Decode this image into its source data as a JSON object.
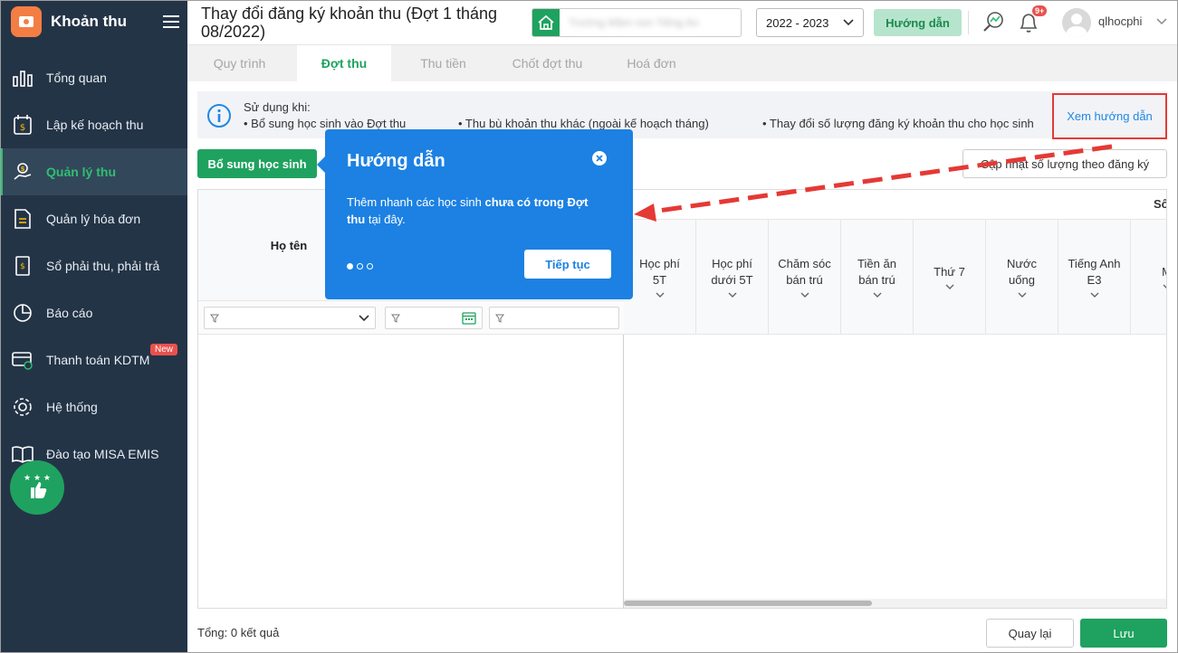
{
  "app": {
    "title": "Khoản thu"
  },
  "sidebar": {
    "items": [
      {
        "label": "Tổng quan"
      },
      {
        "label": "Lập kế hoạch thu"
      },
      {
        "label": "Quản lý thu"
      },
      {
        "label": "Quản lý hóa đơn"
      },
      {
        "label": "Sổ phải thu, phải trả"
      },
      {
        "label": "Báo cáo"
      },
      {
        "label": "Thanh toán KDTM",
        "badge": "New"
      },
      {
        "label": "Hệ thống"
      },
      {
        "label": "Đào tạo MISA EMIS"
      }
    ]
  },
  "header": {
    "title": "Thay đổi đăng ký khoản thu (Đợt 1 tháng 08/2022)",
    "school_name": "Trường Mầm non Tiếng An",
    "year": "2022 - 2023",
    "guide_label": "Hướng dẫn",
    "notif_count": "9+",
    "username": "qlhocphi"
  },
  "tabs": [
    "Quy trình",
    "Đợt thu",
    "Thu tiền",
    "Chốt đợt thu",
    "Hoá đơn"
  ],
  "info": {
    "title": "Sử dụng khi:",
    "bullets": [
      "• Bổ sung học sinh vào Đợt thu",
      "• Thu bù khoản thu khác (ngoài kế hoạch tháng)",
      "• Thay đổi số lượng đăng ký khoản thu cho học sinh"
    ],
    "view_guide": "Xem hướng dẫn"
  },
  "actions": {
    "add_student": "Bổ sung học sinh",
    "update_qty": "Cập nhật số lượng theo đăng ký"
  },
  "grid": {
    "name_header": "Họ tên",
    "group_header": "Số",
    "columns": [
      {
        "line1": "Học phí",
        "line2": "5T"
      },
      {
        "line1": "Học phí",
        "line2": "dưới 5T"
      },
      {
        "line1": "Chăm sóc",
        "line2": "bán trú"
      },
      {
        "line1": "Tiền ăn",
        "line2": "bán trú"
      },
      {
        "line1": "Thứ 7",
        "line2": ""
      },
      {
        "line1": "Nước",
        "line2": "uống"
      },
      {
        "line1": "Tiếng Anh",
        "line2": "E3"
      },
      {
        "line1": "M",
        "line2": ""
      }
    ]
  },
  "footer": {
    "total": "Tổng: 0 kết quả",
    "back": "Quay lại",
    "save": "Lưu"
  },
  "popup": {
    "title": "Hướng dẫn",
    "body_pre": "Thêm nhanh các học sinh ",
    "body_bold": "chưa có trong Đợt thu",
    "body_post": " tại đây.",
    "next": "Tiếp tục"
  },
  "colors": {
    "sidebar_bg": "#243447",
    "accent_green": "#1fa25f",
    "popup_blue": "#1c81e2",
    "highlight_red": "#e53935"
  }
}
